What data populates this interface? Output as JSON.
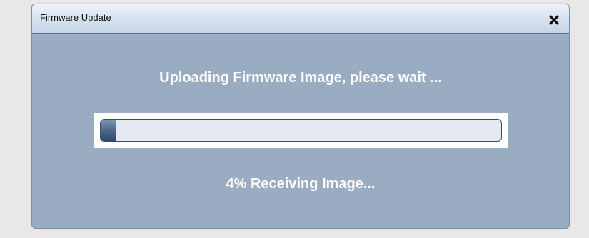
{
  "dialog": {
    "title": "Firmware Update",
    "close_icon": "close-icon",
    "heading": "Uploading Firmware Image, please wait ...",
    "progress": {
      "percent": 4,
      "status_text": "4% Receiving Image..."
    }
  },
  "colors": {
    "page_background": "#e8e8e8",
    "dialog_body": "#9aacc1",
    "titlebar_top": "#eef3fa",
    "titlebar_bottom": "#c3d3e6",
    "progress_fill": "#4c678a",
    "progress_track": "#e4e9f1"
  }
}
